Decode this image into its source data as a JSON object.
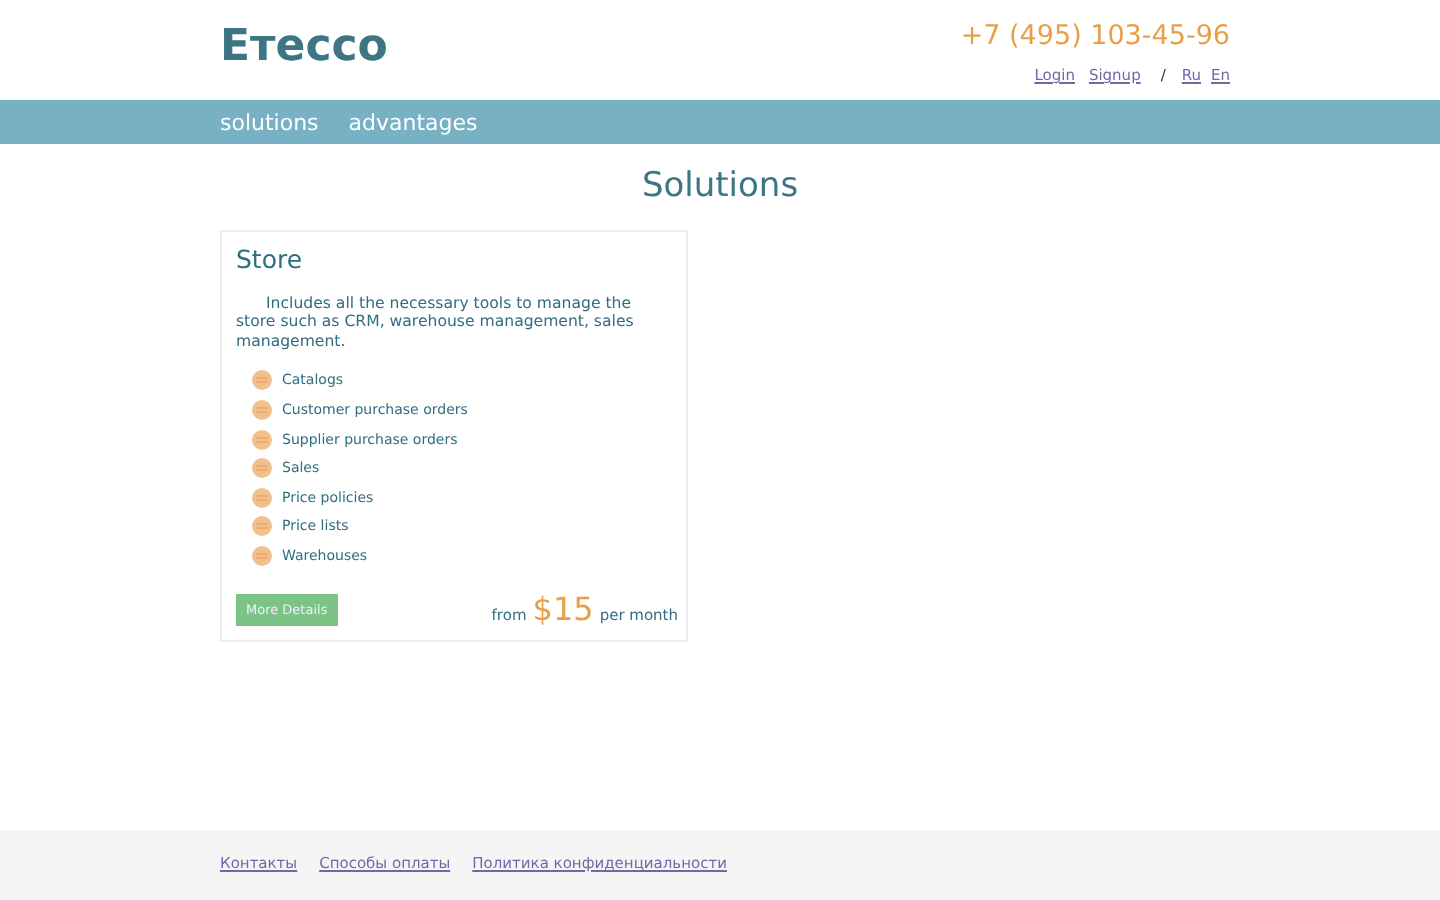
{
  "header": {
    "logo": "Етессо",
    "phone": "+7 (495) 103-45-96",
    "links": [
      "Login",
      "Signup"
    ],
    "separator": "/",
    "languages": [
      "Ru",
      "En"
    ]
  },
  "nav": {
    "items": [
      "solutions",
      "advantages"
    ]
  },
  "page_title": "Solutions",
  "card": {
    "title": "Store",
    "description": "Includes all the necessary tools to manage the store such as CRM, warehouse management, sales management.",
    "features": [
      "Catalogs",
      "Customer purchase orders",
      "Supplier purchase orders",
      "Sales",
      "Price policies",
      "Price lists",
      "Warehouses"
    ],
    "button": "More Details",
    "price_prefix": "from",
    "price": "$15",
    "price_suffix": "per month"
  },
  "footer": {
    "links": [
      "Контакты",
      "Способы оплаты",
      "Политика конфиденциальности"
    ]
  }
}
